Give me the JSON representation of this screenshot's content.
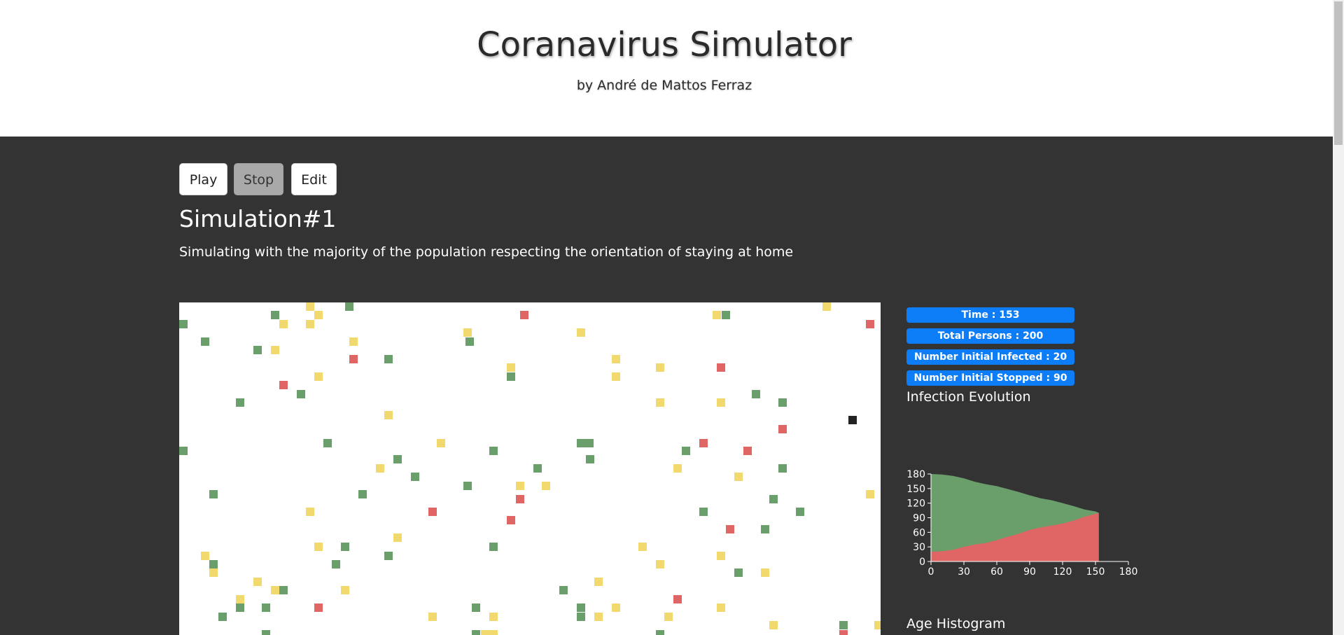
{
  "header": {
    "title": "Coranavirus Simulator",
    "subtitle": "by André de Mattos Ferraz"
  },
  "controls": {
    "play_label": "Play",
    "stop_label": "Stop",
    "edit_label": "Edit"
  },
  "simulation": {
    "title": "Simulation#1",
    "description": "Simulating with the majority of the population respecting the orientation of staying at home"
  },
  "stats": {
    "time": "Time : 153",
    "total_persons": "Total Persons : 200",
    "initial_infected": "Number Initial Infected : 20",
    "initial_stopped": "Number Initial Stopped : 90"
  },
  "sections": {
    "infection_evolution": "Infection Evolution",
    "age_histogram": "Age Histogram"
  },
  "colors": {
    "healthy": "#6a9e6a",
    "infected": "#e06666",
    "stopped": "#f2d96e",
    "selected": "#222222",
    "badge": "#0d7df7"
  },
  "chart_data": {
    "type": "area",
    "title": "Infection Evolution",
    "xlabel": "",
    "ylabel": "",
    "xlim": [
      0,
      180
    ],
    "ylim": [
      0,
      180
    ],
    "x_ticks": [
      0,
      30,
      60,
      90,
      120,
      150,
      180
    ],
    "y_ticks": [
      0,
      30,
      60,
      90,
      120,
      150,
      180
    ],
    "x": [
      0,
      10,
      20,
      30,
      40,
      50,
      60,
      70,
      80,
      90,
      100,
      110,
      120,
      130,
      140,
      150,
      153
    ],
    "series": [
      {
        "color": "#6a9e6a",
        "values": [
          180,
          179,
          176,
          171,
          164,
          159,
          155,
          149,
          143,
          136,
          130,
          126,
          120,
          114,
          107,
          103,
          100
        ]
      },
      {
        "color": "#e06666",
        "values": [
          20,
          21,
          24,
          30,
          35,
          38,
          44,
          51,
          57,
          65,
          70,
          74,
          78,
          84,
          92,
          98,
          100
        ]
      }
    ]
  }
}
